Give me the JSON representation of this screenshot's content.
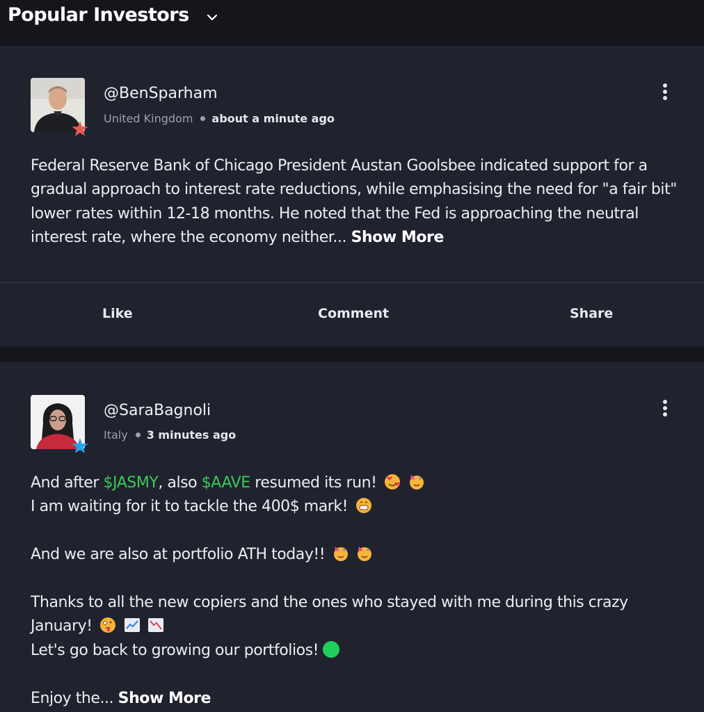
{
  "header": {
    "title": "Popular Investors",
    "chevron_icon": "chevron-down-icon"
  },
  "posts": [
    {
      "username": "@BenSparham",
      "country": "United Kingdom",
      "time": "about a minute ago",
      "star_color": "#e85a55",
      "text": "Federal Reserve Bank of Chicago President Austan Goolsbee indicated support for a gradual approach to interest rate reductions, while emphasising the need for \"a fair bit\" lower rates within 12-18 months. He noted that the Fed is approaching the neutral interest rate, where the economy neither...",
      "show_more": "Show More",
      "actions": {
        "like": "Like",
        "comment": "Comment",
        "share": "Share"
      }
    },
    {
      "username": "@SaraBagnoli",
      "country": "Italy",
      "time": "3 minutes ago",
      "star_color": "#2aa4ef",
      "line1_a": "And after ",
      "ticker1": "$JASMY",
      "line1_b": ", also ",
      "ticker2": "$AAVE",
      "line1_c": " resumed its run!",
      "line2": "I am waiting for it to tackle the 400$ mark!",
      "line3": "And we are also at portfolio ATH today!!",
      "line4": "Thanks to all the new copiers and the ones who stayed with me during this crazy January!",
      "line5": "Let's go back to growing our portfolios!",
      "line6": "Enjoy the...",
      "show_more": "Show More",
      "ticker_color": "#3ac955"
    }
  ]
}
